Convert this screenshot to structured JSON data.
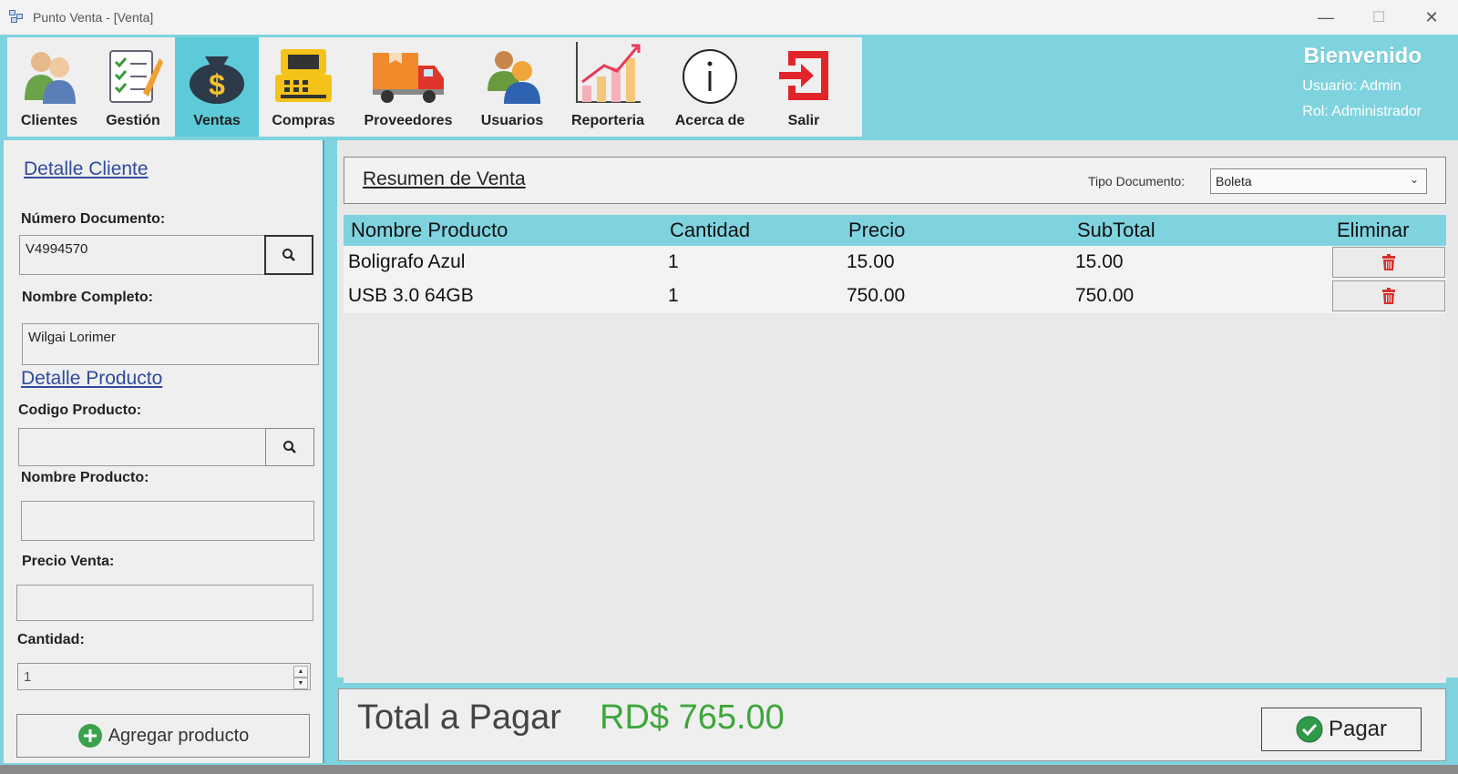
{
  "window": {
    "title": "Punto Venta - [Venta]",
    "minimize": "—",
    "maximize": "☐",
    "close": "✕"
  },
  "menu": {
    "items": [
      {
        "label": "Clientes",
        "icon": "clients-icon"
      },
      {
        "label": "Gestión",
        "icon": "checklist-icon"
      },
      {
        "label": "Ventas",
        "icon": "money-bag-icon",
        "active": true
      },
      {
        "label": "Compras",
        "icon": "cash-register-icon"
      },
      {
        "label": "Proveedores",
        "icon": "truck-icon"
      },
      {
        "label": "Usuarios",
        "icon": "users-icon"
      },
      {
        "label": "Reporteria",
        "icon": "chart-icon"
      },
      {
        "label": "Acerca de",
        "icon": "info-icon"
      },
      {
        "label": "Salir",
        "icon": "exit-icon"
      }
    ]
  },
  "welcome": {
    "greeting": "Bienvenido",
    "user_line": "Usuario:  Admin",
    "role_line": "Rol:  Administrador"
  },
  "cliente": {
    "section_title": "Detalle Cliente",
    "doc_label": "Número Documento:",
    "doc_value": "V4994570",
    "name_label": "Nombre Completo:",
    "name_value": "Wilgai Lorimer"
  },
  "producto": {
    "section_title": "Detalle Producto",
    "code_label": "Codigo Producto:",
    "code_value": "",
    "name_label": "Nombre Producto:",
    "name_value": "",
    "price_label": "Precio Venta:",
    "price_value": "",
    "qty_label": "Cantidad:",
    "qty_value": "1",
    "add_button": "Agregar producto"
  },
  "resumen": {
    "title": "Resumen de Venta",
    "tipo_label": "Tipo Documento:",
    "tipo_value": "Boleta"
  },
  "grid": {
    "columns": [
      "Nombre Producto",
      "Cantidad",
      "Precio",
      "SubTotal",
      "Eliminar"
    ],
    "rows": [
      {
        "producto": "Boligrafo Azul",
        "cantidad": "1",
        "precio": "15.00",
        "subtotal": "15.00"
      },
      {
        "producto": "USB 3.0 64GB",
        "cantidad": "1",
        "precio": "750.00",
        "subtotal": "750.00"
      }
    ]
  },
  "total": {
    "label": "Total a Pagar",
    "value": "RD$ 765.00",
    "pay_button": "Pagar"
  },
  "colors": {
    "accent": "#7fd3df",
    "active_tab": "#5ccad9",
    "total_green": "#3ea63a",
    "delete_red": "#d9302c"
  }
}
